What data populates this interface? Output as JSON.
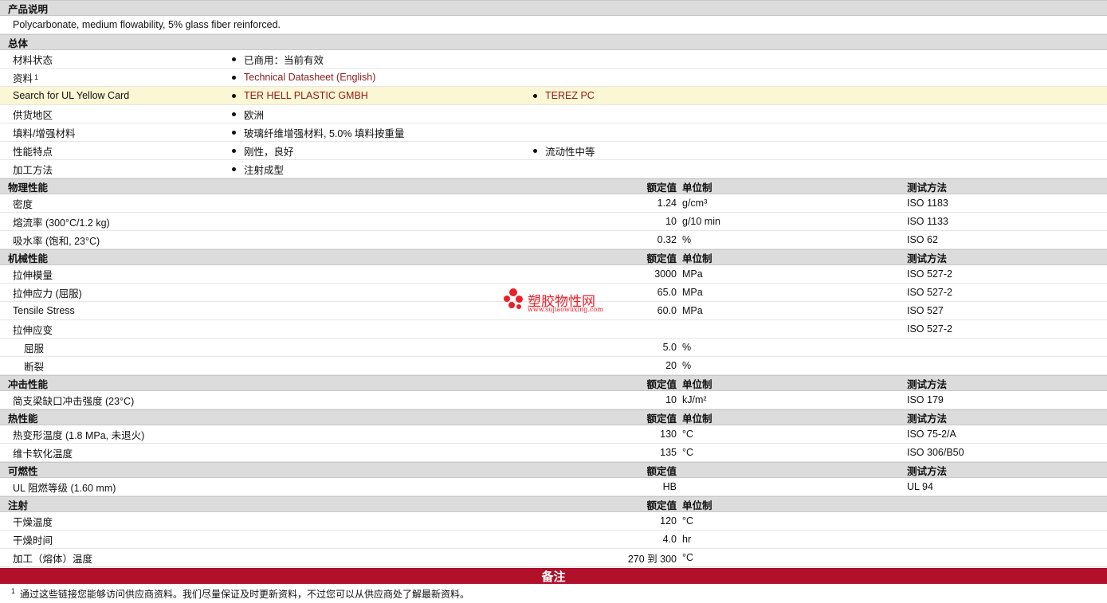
{
  "description": {
    "header": "产品说明",
    "text": "Polycarbonate, medium flowability, 5% glass fiber reinforced."
  },
  "general": {
    "header": "总体",
    "status_label": "材料状态",
    "status_value": "已商用：当前有效",
    "docs_label": "资料",
    "docs_sup": "1",
    "docs_link": "Technical Datasheet (English)",
    "ul_label": "Search for UL Yellow Card",
    "ul_link1": "TER HELL PLASTIC GMBH",
    "ul_link2": "TEREZ PC",
    "region_label": "供货地区",
    "region_value": "欧洲",
    "filler_label": "填料/增强材料",
    "filler_value": "玻璃纤维增强材料, 5.0% 填料按重量",
    "features_label": "性能特点",
    "features_value1": "刚性，良好",
    "features_value2": "流动性中等",
    "processing_label": "加工方法",
    "processing_value": "注射成型"
  },
  "columns": {
    "nominal": "额定值",
    "unit": "单位制",
    "test": "测试方法"
  },
  "physical": {
    "header": "物理性能",
    "rows": [
      {
        "label": "密度",
        "value": "1.24",
        "unit": "g/cm³",
        "test": "ISO 1183"
      },
      {
        "label": "熔流率  (300°C/1.2 kg)",
        "value": "10",
        "unit": "g/10 min",
        "test": "ISO 1133"
      },
      {
        "label": "吸水率  (饱和, 23°C)",
        "value": "0.32",
        "unit": "%",
        "test": "ISO 62"
      }
    ]
  },
  "mechanical": {
    "header": "机械性能",
    "rows": [
      {
        "label": "拉伸模量",
        "value": "3000",
        "unit": "MPa",
        "test": "ISO 527-2"
      },
      {
        "label": "拉伸应力  (屈服)",
        "value": "65.0",
        "unit": "MPa",
        "test": "ISO 527-2"
      },
      {
        "label": "Tensile Stress",
        "value": "60.0",
        "unit": "MPa",
        "test": "ISO 527"
      },
      {
        "label": "拉伸应变",
        "value": "",
        "unit": "",
        "test": "ISO 527-2"
      },
      {
        "label": "屈服",
        "value": "5.0",
        "unit": "%",
        "test": ""
      },
      {
        "label": "断裂",
        "value": "20",
        "unit": "%",
        "test": ""
      }
    ]
  },
  "impact": {
    "header": "冲击性能",
    "rows": [
      {
        "label": "简支梁缺口冲击强度  (23°C)",
        "value": "10",
        "unit": "kJ/m²",
        "test": "ISO 179"
      }
    ]
  },
  "thermal": {
    "header": "热性能",
    "rows": [
      {
        "label": "热变形温度  (1.8 MPa, 未退火)",
        "value": "130",
        "unit": "°C",
        "test": "ISO 75-2/A"
      },
      {
        "label": "维卡软化温度",
        "value": "135",
        "unit": "°C",
        "test": "ISO 306/B50"
      }
    ]
  },
  "flammability": {
    "header": "可燃性",
    "rows": [
      {
        "label": "UL 阻燃等级  (1.60 mm)",
        "value": "HB",
        "unit": "",
        "test": "UL 94"
      }
    ]
  },
  "injection": {
    "header": "注射",
    "rows": [
      {
        "label": "干燥温度",
        "value": "120",
        "unit": "°C",
        "test": ""
      },
      {
        "label": "干燥时间",
        "value": "4.0",
        "unit": "hr",
        "test": ""
      },
      {
        "label": "加工（熔体）温度",
        "value": "270 到  300",
        "unit": "°C",
        "test": ""
      }
    ]
  },
  "notes": {
    "title": "备注",
    "footnote_sup": "1",
    "footnote_text": "通过这些链接您能够访问供应商资料。我们尽量保证及时更新资料，不过您可以从供应商处了解最新资料。"
  },
  "watermark": {
    "name": "塑胶物性网",
    "url": "www.sujiaowuxing.com"
  }
}
